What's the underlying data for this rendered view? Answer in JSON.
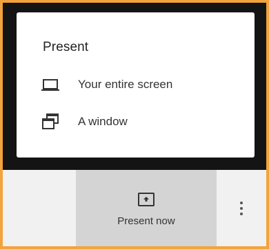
{
  "menu": {
    "title": "Present",
    "items": [
      {
        "label": "Your entire screen",
        "icon": "laptop-icon"
      },
      {
        "label": "A window",
        "icon": "window-icon"
      }
    ]
  },
  "bottom_bar": {
    "present_now_label": "Present now",
    "present_now_icon": "present-to-all-icon",
    "more_icon": "more-vertical-icon"
  },
  "colors": {
    "frame_border": "#f3a33b",
    "dark_background": "#141414",
    "menu_background": "#ffffff",
    "active_tab": "#d4d4d4",
    "bar_background": "#f1f1f1"
  }
}
